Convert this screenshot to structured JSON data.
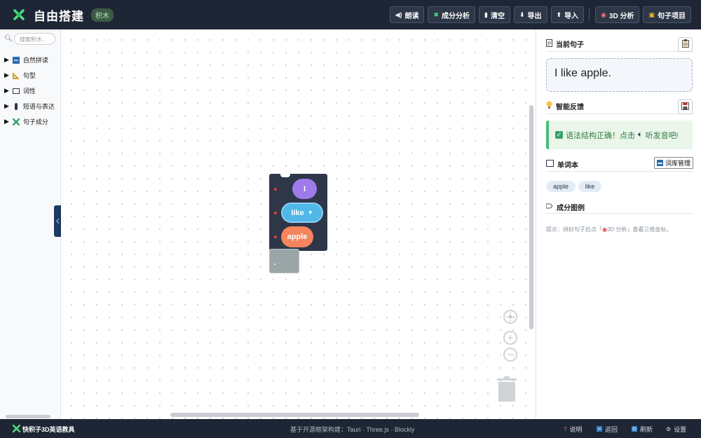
{
  "header": {
    "title": "自由搭建",
    "badge": "积木",
    "buttons": {
      "read": "朗读",
      "analyze": "成分分析",
      "clear": "清空",
      "export": "导出",
      "import": "导入",
      "analysis_3d": "3D 分析",
      "sentence_project": "句子项目"
    }
  },
  "toolbox": {
    "search_placeholder": "搜索积木...",
    "categories": [
      {
        "label": "自然拼读",
        "icon": "blue-square-icon"
      },
      {
        "label": "句型",
        "icon": "ruler-icon"
      },
      {
        "label": "词性",
        "icon": "box-icon"
      },
      {
        "label": "短语与表达",
        "icon": "pill-icon"
      },
      {
        "label": "句子成分",
        "icon": "puzzle-icon"
      }
    ]
  },
  "workspace": {
    "words": [
      "I",
      "like",
      "apple"
    ]
  },
  "panel": {
    "current_sentence_title": "当前句子",
    "current_sentence": "I like apple.",
    "feedback_title": "智能反馈",
    "feedback_text": "语法结构正确！点击",
    "feedback_link": "听发音吧!",
    "vocab_title": "单词本",
    "vocab_manage": "词库管理",
    "vocab_words": [
      "apple",
      "like"
    ],
    "legend_title": "成分图例",
    "hint_prefix": "提示：拼好句子后点「",
    "hint_button": "3D 分析",
    "hint_suffix": "」查看三维坐标。"
  },
  "footer": {
    "app_name": "快积子3D英语教具",
    "built_with": "基于开源框架构建：Tauri · Three.js · Blockly",
    "help": "说明",
    "back": "返回",
    "refresh": "刷新",
    "settings": "设置"
  },
  "colors": {
    "header_bg": "#1e2635",
    "block_bg": "#2d3748",
    "word_I": "#9f7aea",
    "word_like": "#4fb8e8",
    "word_apple": "#f6845c",
    "feedback_green": "#48bb78"
  }
}
